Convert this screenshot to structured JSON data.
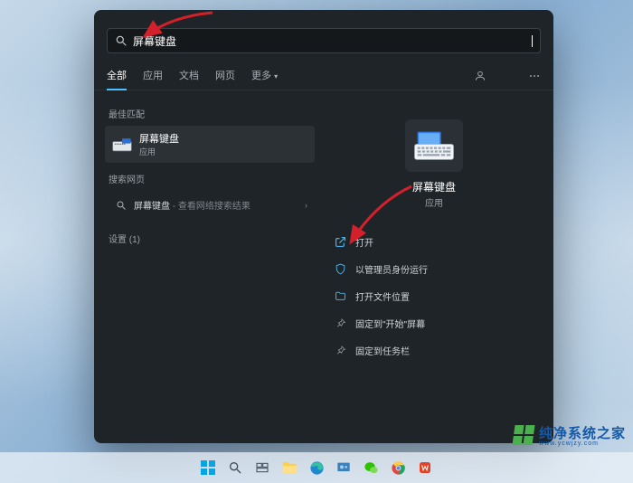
{
  "search": {
    "value": "屏幕键盘"
  },
  "tabs": [
    "全部",
    "应用",
    "文档",
    "网页",
    "更多"
  ],
  "best_match": {
    "label": "最佳匹配"
  },
  "best_item": {
    "title": "屏幕键盘",
    "subtitle": "应用"
  },
  "search_web": {
    "label": "搜索网页"
  },
  "web_item": {
    "term": "屏幕键盘",
    "hint": " - 查看网络搜索结果"
  },
  "settings_section": {
    "label": "设置 (1)"
  },
  "detail": {
    "title": "屏幕键盘",
    "type": "应用"
  },
  "actions": {
    "open": "打开",
    "run_admin": "以管理员身份运行",
    "open_location": "打开文件位置",
    "pin_start": "固定到\"开始\"屏幕",
    "pin_taskbar": "固定到任务栏"
  },
  "watermark": {
    "brand": "纯净系统之家",
    "url": "www.ycwjzy.com"
  },
  "colors": {
    "accent": "#4cc2ff",
    "panel": "#1f2428"
  }
}
